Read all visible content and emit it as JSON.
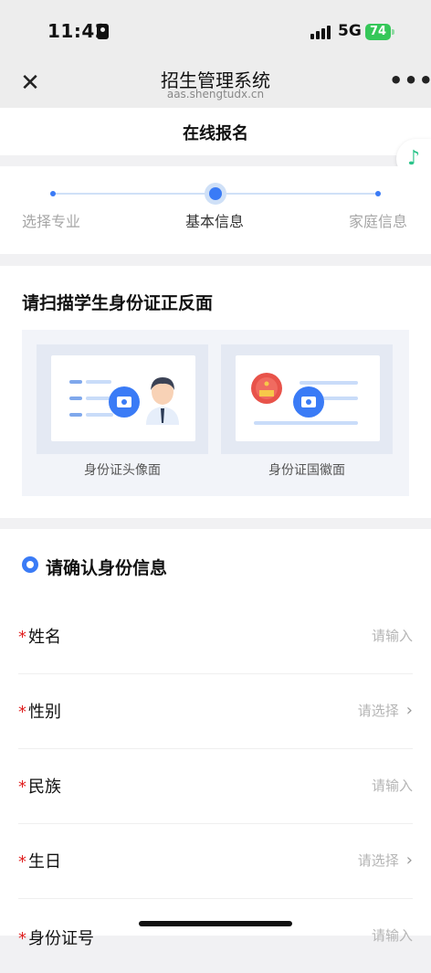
{
  "status": {
    "time": "11:42",
    "network": "5G",
    "battery": "74"
  },
  "nav": {
    "title": "招生管理系统",
    "subtitle": "aas.shengtudx.cn",
    "close_icon": "close-icon",
    "more": "•••"
  },
  "page": {
    "title": "在线报名"
  },
  "steps": [
    {
      "label": "选择专业",
      "active": false
    },
    {
      "label": "基本信息",
      "active": true
    },
    {
      "label": "家庭信息",
      "active": false
    }
  ],
  "scan": {
    "title": "请扫描学生身份证正反面",
    "front_caption": "身份证头像面",
    "back_caption": "身份证国徽面"
  },
  "form": {
    "header": "请确认身份信息",
    "fields": [
      {
        "label": "姓名",
        "placeholder": "请输入",
        "type": "input"
      },
      {
        "label": "性别",
        "placeholder": "请选择",
        "type": "select"
      },
      {
        "label": "民族",
        "placeholder": "请输入",
        "type": "input"
      },
      {
        "label": "生日",
        "placeholder": "请选择",
        "type": "select"
      },
      {
        "label": "身份证号",
        "placeholder": "请输入",
        "type": "input"
      }
    ],
    "required_mark": "*",
    "chevron": "›"
  },
  "colors": {
    "accent": "#3a7bf6",
    "required": "#e02020",
    "battery": "#35c759"
  }
}
